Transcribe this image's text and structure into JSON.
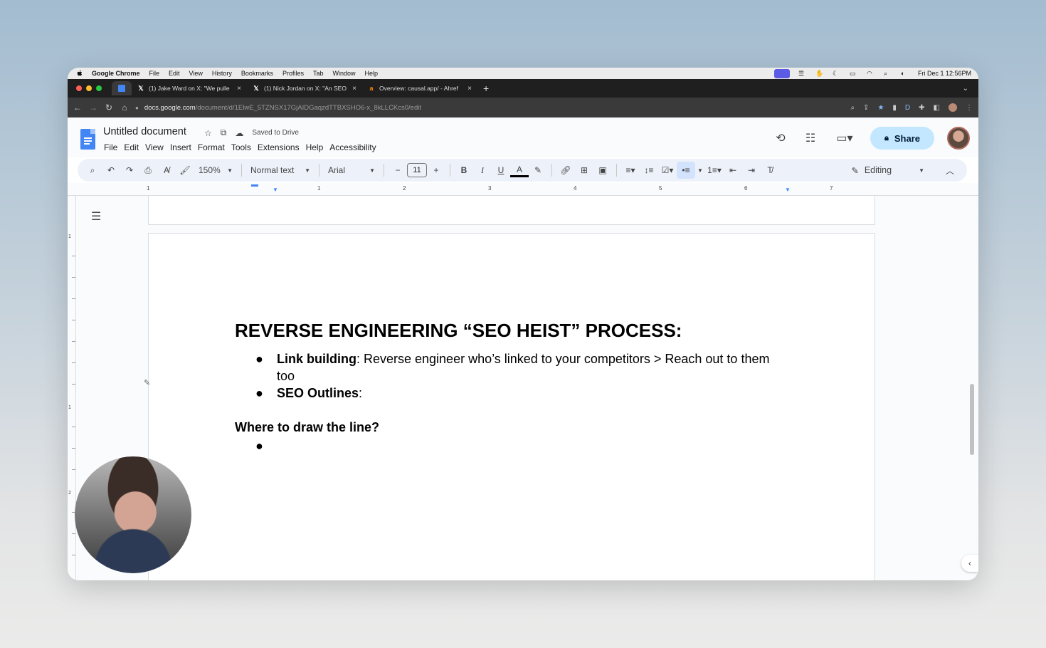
{
  "mac_menubar": {
    "app": "Google Chrome",
    "items": [
      "File",
      "Edit",
      "View",
      "History",
      "Bookmarks",
      "Profiles",
      "Tab",
      "Window",
      "Help"
    ],
    "datetime": "Fri Dec 1  12:56PM"
  },
  "tabs": [
    {
      "favicon": "google-docs-icon",
      "title": ""
    },
    {
      "favicon": "x-icon",
      "title": "(1) Jake Ward on X: \"We pulle"
    },
    {
      "favicon": "x-icon",
      "title": "(1) Nick Jordan on X: \"An SEO"
    },
    {
      "favicon": "ahrefs-icon",
      "title": "Overview: causal.app/ - Ahref"
    }
  ],
  "address_bar": {
    "domain": "docs.google.com",
    "path": "/document/d/1ElwE_5TZNSX17GjAIDGaqzdTTBXSHO6-x_8kLLCKcs0/edit"
  },
  "docs_header": {
    "title": "Untitled document",
    "saved_status": "Saved to Drive",
    "menu": [
      "File",
      "Edit",
      "View",
      "Insert",
      "Format",
      "Tools",
      "Extensions",
      "Help",
      "Accessibility"
    ],
    "share_label": "Share"
  },
  "toolbar": {
    "zoom": "150%",
    "style": "Normal text",
    "font": "Arial",
    "font_size": "11",
    "mode": "Editing"
  },
  "ruler_numbers": [
    "1",
    "1",
    "2",
    "3",
    "4",
    "5",
    "6",
    "7"
  ],
  "vertical_ruler_numbers": [
    "1",
    "1",
    "2"
  ],
  "document": {
    "heading": "REVERSE ENGINEERING “SEO HEIST” PROCESS:",
    "bullets": [
      {
        "bold": "Link building",
        "text": ": Reverse engineer who’s linked to your competitors > Reach out to them too"
      },
      {
        "bold": "SEO Outlines",
        "text": ":"
      }
    ],
    "subheading": "Where to draw the line?",
    "empty_bullet": ""
  },
  "colors": {
    "share_bg": "#c2e7ff",
    "toolbar_bg": "#edf2fa",
    "docs_blue": "#4285f4"
  }
}
